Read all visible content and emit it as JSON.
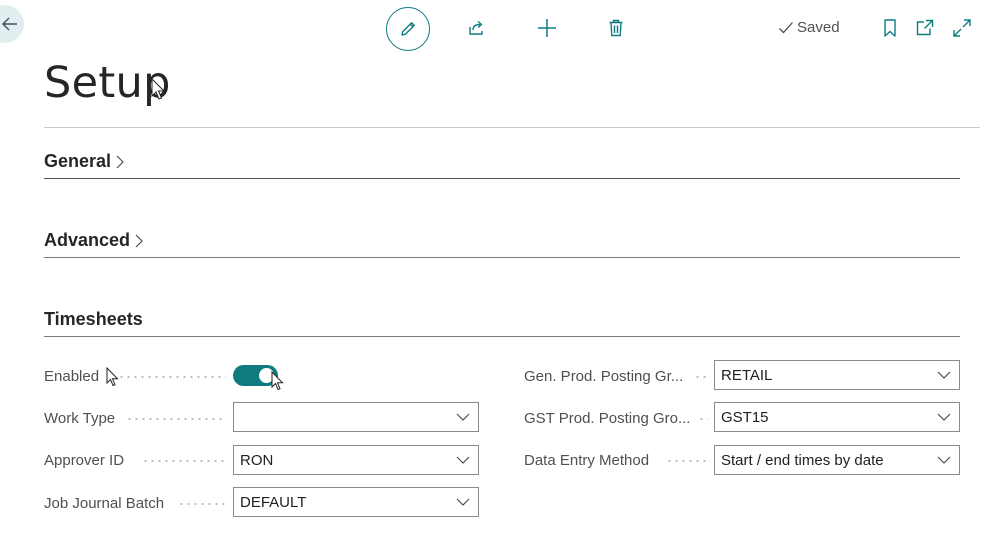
{
  "toolbar": {
    "saved_label": "Saved"
  },
  "page": {
    "title": "Setup"
  },
  "sections": {
    "general": "General",
    "advanced": "Advanced",
    "timesheets": "Timesheets"
  },
  "fields": {
    "enabled_label": "Enabled",
    "enabled_value": true,
    "work_type_label": "Work Type",
    "work_type_value": "",
    "approver_label": "Approver ID",
    "approver_value": "RON",
    "job_batch_label": "Job Journal Batch",
    "job_batch_value": "DEFAULT",
    "gen_prod_label": "Gen. Prod. Posting Gr...",
    "gen_prod_value": "RETAIL",
    "gst_prod_label": "GST Prod. Posting Gro...",
    "gst_prod_value": "GST15",
    "data_entry_label": "Data Entry Method",
    "data_entry_value": "Start / end times by date"
  },
  "colors": {
    "accent": "#0f7b80"
  },
  "icons": [
    "back-arrow-icon",
    "pencil-icon",
    "share-icon",
    "plus-icon",
    "trash-icon",
    "checkmark-icon",
    "bookmark-icon",
    "open-new-window-icon",
    "expand-icon",
    "chevron-right-icon",
    "chevron-down-icon",
    "mouse-cursor-icon"
  ]
}
